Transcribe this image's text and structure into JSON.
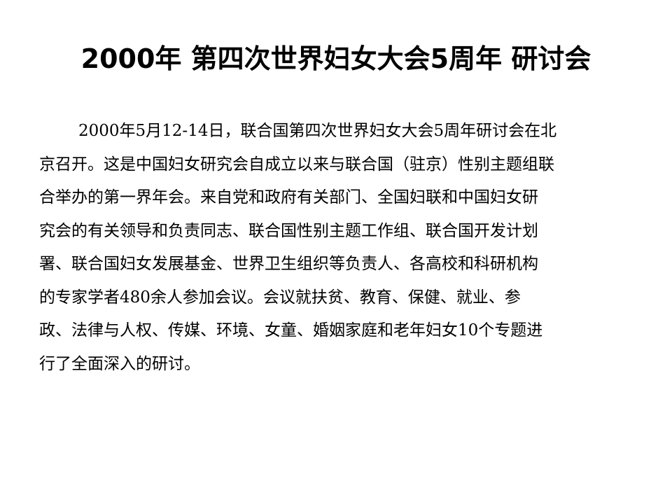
{
  "slide": {
    "title": "2000年 第四次世界妇女大会5周年 研讨会",
    "paragraph_lines": [
      "2000年5月12-14日，联合国第四次世界妇女大会5周年研讨会在北",
      "京召开。这是中国妇女研究会自成立以来与联合国（驻京）性别主题组联",
      "合举办的第一界年会。来自党和政府有关部门、全国妇联和中国妇女研",
      "究会的有关领导和负责同志、联合国性别主题工作组、联合国开发计划",
      "署、联合国妇女发展基金、世界卫生组织等负责人、各高校和科研机构",
      "的专家学者480余人参加会议。会议就扶贫、教育、保健、就业、参",
      "政、法律与人权、传媒、环境、女童、婚姻家庭和老年妇女10个专题进",
      "行了全面深入的研讨。"
    ]
  }
}
